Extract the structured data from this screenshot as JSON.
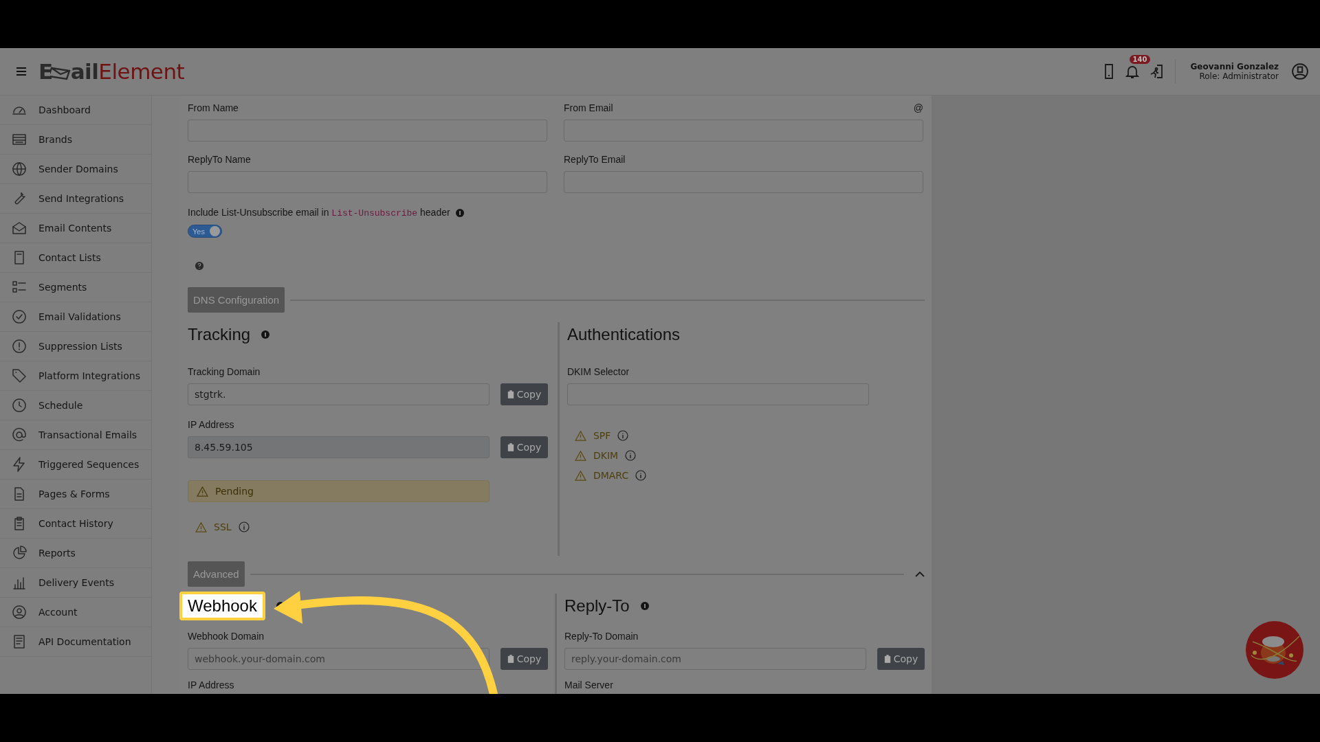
{
  "header": {
    "logo": {
      "start": "E",
      "middle": "ail",
      "end": "Element"
    },
    "notification_count": "140",
    "user": {
      "name": "Geovanni Gonzalez",
      "role": "Role: Administrator"
    }
  },
  "sidebar": {
    "items": [
      {
        "label": "Dashboard"
      },
      {
        "label": "Brands"
      },
      {
        "label": "Sender Domains"
      },
      {
        "label": "Send Integrations"
      },
      {
        "label": "Email Contents"
      },
      {
        "label": "Contact Lists"
      },
      {
        "label": "Segments"
      },
      {
        "label": "Email Validations"
      },
      {
        "label": "Suppression Lists"
      },
      {
        "label": "Platform Integrations"
      },
      {
        "label": "Schedule"
      },
      {
        "label": "Transactional Emails"
      },
      {
        "label": "Triggered Sequences"
      },
      {
        "label": "Pages & Forms"
      },
      {
        "label": "Contact History"
      },
      {
        "label": "Reports"
      },
      {
        "label": "Delivery Events"
      },
      {
        "label": "Account"
      },
      {
        "label": "API Documentation"
      }
    ]
  },
  "form": {
    "fields": [
      {
        "label": "From Name"
      },
      {
        "label": "From Email",
        "hint": "@"
      },
      {
        "label": "ReplyTo Name"
      },
      {
        "label": "ReplyTo Email"
      }
    ],
    "unsubscribe": {
      "before": "Include List-Unsubscribe email in",
      "code": "List-Unsubscribe",
      "after": "header",
      "toggle": {
        "label": "Yes",
        "on": true
      }
    }
  },
  "dns": {
    "section": "DNS Configuration",
    "tracking": {
      "title": "Tracking",
      "fields": [
        {
          "label": "Tracking Domain",
          "value": "stgtrk.",
          "readonly": false,
          "copy": "Copy"
        },
        {
          "label": "IP Address",
          "value": "8.45.59.105",
          "readonly": true,
          "copy": "Copy"
        }
      ],
      "status": "Pending",
      "checks": [
        "SSL"
      ]
    },
    "authentications": {
      "title": "Authentications",
      "field": {
        "label": "DKIM Selector"
      },
      "checks": [
        "SPF",
        "DKIM",
        "DMARC"
      ]
    }
  },
  "advanced": {
    "section": "Advanced",
    "expanded": true,
    "webhook": {
      "title": "Webhook",
      "highlighted": true,
      "field": {
        "label": "Webhook Domain",
        "placeholder": "webhook.your-domain.com",
        "copy": "Copy"
      },
      "next_label": "IP Address"
    },
    "reply_to": {
      "title": "Reply-To",
      "field": {
        "label": "Reply-To Domain",
        "placeholder": "reply.your-domain.com",
        "copy": "Copy"
      },
      "next_label": "Mail Server"
    }
  }
}
